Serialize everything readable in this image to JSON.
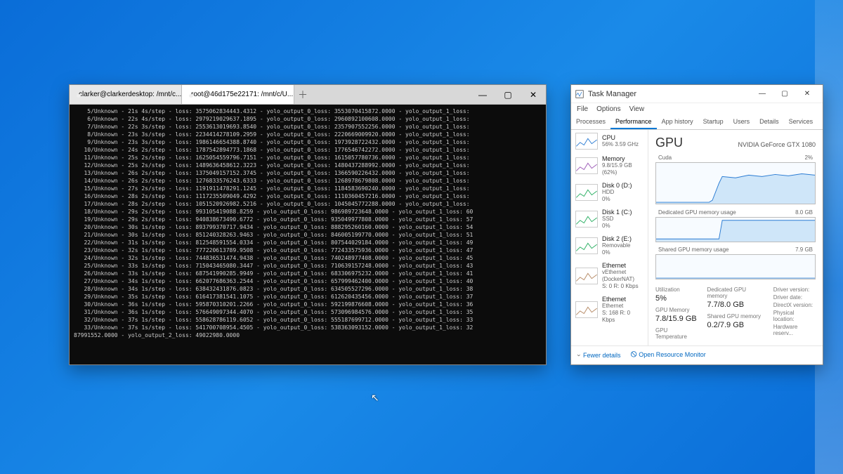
{
  "terminal": {
    "tabs": [
      {
        "title": "clarker@clarkerdesktop: /mnt/c..."
      },
      {
        "title": "root@46d175e22171: /mnt/c/U..."
      }
    ],
    "lines": [
      "    5/Unknown - 21s 4s/step - loss: 3575062834443.4312 - yolo_output_0_loss: 3553070415872.0000 - yolo_output_1_loss:",
      "    6/Unknown - 22s 4s/step - loss: 2979219029637.1895 - yolo_output_0_loss: 2960892100608.0000 - yolo_output_1_loss:",
      "    7/Unknown - 22s 3s/step - loss: 2553613019693.8540 - yolo_output_0_loss: 2357907552256.0000 - yolo_output_1_loss:",
      "    8/Unknown - 23s 3s/step - loss: 2234414278109.2959 - yolo_output_0_loss: 2220669009920.0000 - yolo_output_1_loss:",
      "    9/Unknown - 23s 3s/step - loss: 1986146654388.8740 - yolo_output_0_loss: 1973928722432.0000 - yolo_output_1_loss:",
      "   10/Unknown - 24s 2s/step - loss: 1787542894773.1868 - yolo_output_0_loss: 1776546742272.0000 - yolo_output_1_loss:",
      "   11/Unknown - 25s 2s/step - loss: 1625054559796.7151 - yolo_output_0_loss: 1615057780736.0000 - yolo_output_1_loss:",
      "   12/Unknown - 25s 2s/step - loss: 1489636458612.3223 - yolo_output_0_loss: 1480437288992.0000 - yolo_output_1_loss:",
      "   13/Unknown - 26s 2s/step - loss: 1375049157152.3745 - yolo_output_0_loss: 1366590226432.0000 - yolo_output_1_loss:",
      "   14/Unknown - 26s 2s/step - loss: 1276833576243.6333 - yolo_output_0_loss: 1268978679808.0000 - yolo_output_1_loss:",
      "   15/Unknown - 27s 2s/step - loss: 1191911478291.1245 - yolo_output_0_loss: 1184583690240.0000 - yolo_output_1_loss:",
      "   16/Unknown - 28s 2s/step - loss: 1117235509049.4292 - yolo_output_0_loss: 1110360457216.0000 - yolo_output_1_loss:",
      "   17/Unknown - 28s 2s/step - loss: 1051520926982.5216 - yolo_output_0_loss: 1045045772288.0000 - yolo_output_1_loss:",
      "   18/Unknown - 29s 2s/step - loss: 993105419088.8259 - yolo_output_0_loss: 986989723648.0000 - yolo_output_1_loss: 60",
      "   19/Unknown - 29s 2s/step - loss: 940838673490.6772 - yolo_output_0_loss: 935049977808.0000 - yolo_output_1_loss: 57",
      "   20/Unknown - 30s 1s/step - loss: 893799370717.9434 - yolo_output_0_loss: 888295260160.0000 - yolo_output_1_loss: 54",
      "   21/Unknown - 30s 1s/step - loss: 851240328263.9463 - yolo_output_0_loss: 846005199770.0000 - yolo_output_1_loss: 51",
      "   22/Unknown - 31s 1s/step - loss: 812548591554.0334 - yolo_output_0_loss: 807544029184.0000 - yolo_output_1_loss: 49",
      "   23/Unknown - 32s 1s/step - loss: 777220613789.9508 - yolo_output_0_loss: 772433575936.0000 - yolo_output_1_loss: 47",
      "   24/Unknown - 32s 1s/step - loss: 744836531474.9438 - yolo_output_0_loss: 740248977408.0000 - yolo_output_1_loss: 45",
      "   25/Unknown - 33s 1s/step - loss: 715043465080.3447 - yolo_output_0_loss: 710639157248.0000 - yolo_output_1_loss: 43",
      "   26/Unknown - 33s 1s/step - loss: 687541990285.9949 - yolo_output_0_loss: 683306975232.0000 - yolo_output_1_loss: 41",
      "   27/Unknown - 34s 1s/step - loss: 662077686363.2544 - yolo_output_0_loss: 657999462400.0000 - yolo_output_1_loss: 40",
      "   28/Unknown - 34s 1s/step - loss: 638432431876.0823 - yolo_output_0_loss: 634505527296.0000 - yolo_output_1_loss: 38",
      "   29/Unknown - 35s 1s/step - loss: 616417381541.1075 - yolo_output_0_loss: 612620435456.0000 - yolo_output_1_loss: 37",
      "   30/Unknown - 36s 1s/step - loss: 595870310201.2266 - yolo_output_0_loss: 592199876608.0000 - yolo_output_1_loss: 36",
      "   31/Unknown - 36s 1s/step - loss: 576649097344.4070 - yolo_output_0_loss: 573096984576.0000 - yolo_output_1_loss: 35",
      "   32/Unknown - 37s 1s/step - loss: 558628786119.6052 - yolo_output_0_loss: 555187699712.0000 - yolo_output_1_loss: 33",
      "   33/Unknown - 37s 1s/step - loss: 541700708954.4505 - yolo_output_0_loss: 538363093152.0000 - yolo_output_1_loss: 32",
      "87991552.0000 - yolo_output_2_loss: 49022980.0000"
    ]
  },
  "taskmgr": {
    "title": "Task Manager",
    "menu": [
      "File",
      "Options",
      "View"
    ],
    "tabs": [
      "Processes",
      "Performance",
      "App history",
      "Startup",
      "Users",
      "Details",
      "Services"
    ],
    "active_tab": "Performance",
    "sidebar": [
      {
        "title": "CPU",
        "sub": "56%  3.59 GHz",
        "color": "#2b7cd3"
      },
      {
        "title": "Memory",
        "sub": "9.8/15.9 GB (62%)",
        "color": "#9b59b6"
      },
      {
        "title": "Disk 0 (D:)",
        "sub": "HDD\n0%",
        "color": "#27ae60"
      },
      {
        "title": "Disk 1 (C:)",
        "sub": "SSD\n0%",
        "color": "#27ae60"
      },
      {
        "title": "Disk 2 (E:)",
        "sub": "Removable\n0%",
        "color": "#27ae60"
      },
      {
        "title": "Ethernet",
        "sub": "vEthernet (DockerNAT)\nS: 0  R: 0 Kbps",
        "color": "#b58863"
      },
      {
        "title": "Ethernet",
        "sub": "Ethernet\nS: 168  R: 0 Kbps",
        "color": "#b58863"
      }
    ],
    "gpu": {
      "header": "GPU",
      "model": "NVIDIA GeForce GTX 1080",
      "charts": {
        "cuda": {
          "label": "Cuda",
          "right": "2%"
        },
        "dedicated": {
          "label": "Dedicated GPU memory usage",
          "right": "8.0 GB"
        },
        "shared": {
          "label": "Shared GPU memory usage",
          "right": "7.9 GB"
        }
      },
      "stats": {
        "utilization_lbl": "Utilization",
        "utilization_val": "5%",
        "dedicated_lbl": "Dedicated GPU memory",
        "dedicated_val": "7.7/8.0 GB",
        "gpu_mem_lbl": "GPU Memory",
        "gpu_mem_val": "7.8/15.9 GB",
        "shared_lbl": "Shared GPU memory",
        "shared_val": "0.2/7.9 GB",
        "temp_lbl": "GPU Temperature",
        "driver_labels": [
          "Driver version:",
          "Driver date:",
          "DirectX version:",
          "Physical location:",
          "Hardware reserv..."
        ]
      }
    },
    "footer": {
      "fewer": "Fewer details",
      "monitor": "Open Resource Monitor"
    }
  }
}
